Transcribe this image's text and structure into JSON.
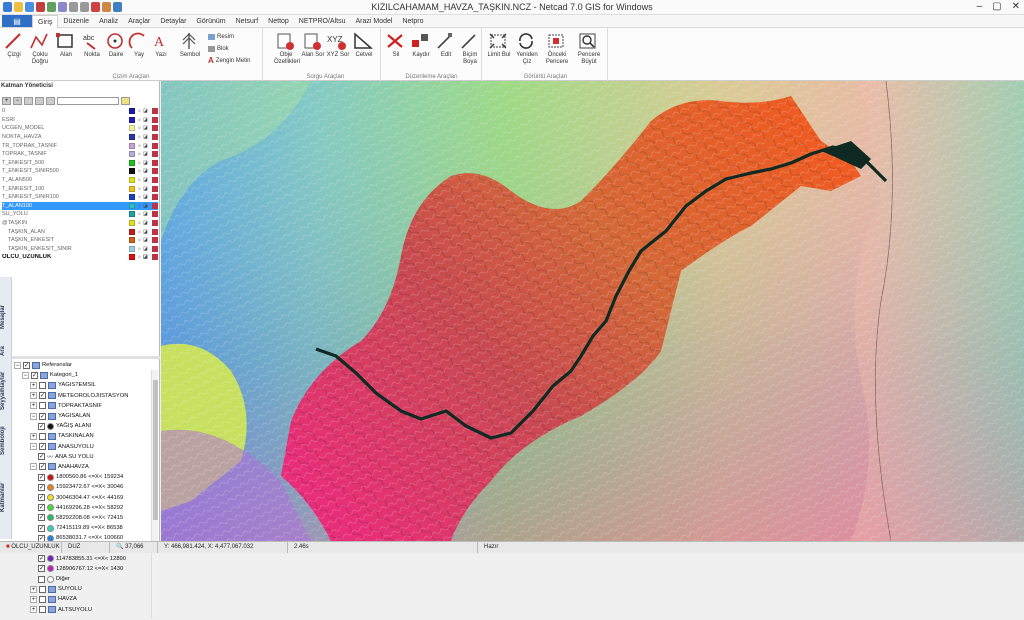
{
  "window": {
    "title": "KIZILCAHAMAM_HAVZA_TAŞKIN.NCZ - Netcad 7.0 GIS for Windows"
  },
  "menu": [
    "Giriş",
    "Düzenle",
    "Analiz",
    "Araçlar",
    "Detaylar",
    "Görünüm",
    "Netsurf",
    "Nettop",
    "NETPRO/Altsu",
    "Arazi Model",
    "Netpro"
  ],
  "ribbon": {
    "draw_tools": [
      "Çizgi",
      "Çoklu Doğru",
      "Alan",
      "Nokta",
      "Daire",
      "Yay",
      "Yazı",
      "Sembol"
    ],
    "draw_small": [
      "Resim",
      "Blok",
      "Zengin Metin"
    ],
    "draw_group": "Çizim Araçları",
    "query_tools": [
      "Obje Özellikleri",
      "Alan Sor",
      "XYZ Sor",
      "Cetvel"
    ],
    "query_group": "Sorgu Araçları",
    "edit_tools": [
      "Sil",
      "Kaydır",
      "Edit",
      "Biçim Boya"
    ],
    "edit_group": "Düzenleme Araçları",
    "view_tools": [
      "Limit Bul",
      "Yeniden Çiz",
      "Önceki Pencere",
      "Pencere Büyüt"
    ],
    "view_group": "Görüntü Araçları"
  },
  "layer_manager": {
    "title": "Katman Yöneticisi",
    "layers": [
      {
        "name": "0",
        "color": "#1a1aa8"
      },
      {
        "name": "ESRI",
        "color": "#2020b0"
      },
      {
        "name": "UCGEN_MODEL",
        "color": "#f0f0a0"
      },
      {
        "name": "NOKTA_HAVZA",
        "color": "#2a3aa8"
      },
      {
        "name": "TR_TOPRAK_TASNIF",
        "color": "#c9a0d8"
      },
      {
        "name": "TOPRAK_TASNIF",
        "color": "#b0b0e0"
      },
      {
        "name": "T_ENKESIT_500",
        "color": "#20c020"
      },
      {
        "name": "T_ENKESIT_SINIR500",
        "color": "#101010"
      },
      {
        "name": "T_ALAN500",
        "color": "#e0e020"
      },
      {
        "name": "T_ENKESIT_100",
        "color": "#f0c020"
      },
      {
        "name": "T_ENKESIT_SINIR100",
        "color": "#2040c0"
      },
      {
        "name": "T_ALAN100",
        "color": "#30c0c0",
        "selected": true
      },
      {
        "name": "SU_YOLU",
        "color": "#20a0a0"
      },
      {
        "name": "@TAŞKIN",
        "color": "#e0e020"
      },
      {
        "name": "TAŞKIN_ALAN",
        "color": "#c02020"
      },
      {
        "name": "TAŞKIN_ENKESIT",
        "color": "#d06020"
      },
      {
        "name": "TAŞKIN_ENKESIT_SINIR",
        "color": "#a0d0e0"
      },
      {
        "name": "OLCU_UZUNLUK",
        "color": "#e01010",
        "bold": true
      }
    ]
  },
  "side_tabs": [
    "Katmanlar",
    "Semboloji",
    "Seyyaihlaylar",
    "Ara",
    "Mesajlar"
  ],
  "tree": {
    "rows": [
      {
        "level": 0,
        "exp": "−",
        "label": "Referanslar",
        "checked": true
      },
      {
        "level": 1,
        "exp": "−",
        "label": "Kategori_1",
        "checked": true
      },
      {
        "level": 2,
        "exp": "+",
        "label": "YAGIS?EMSIL",
        "checked": false
      },
      {
        "level": 2,
        "exp": "+",
        "label": "METEOROLOJIISTASYON",
        "checked": true
      },
      {
        "level": 2,
        "exp": "+",
        "label": "TOPRAKTASNIF",
        "checked": false
      },
      {
        "level": 2,
        "exp": "−",
        "label": "YAGISALAN",
        "checked": true
      },
      {
        "level": 3,
        "label": "YAĞIŞ ALANI",
        "checked": true,
        "dot": "#111"
      },
      {
        "level": 2,
        "exp": "+",
        "label": "TASKINALAN",
        "checked": false
      },
      {
        "level": 2,
        "exp": "−",
        "label": "ANASUYOLU",
        "checked": true
      },
      {
        "level": 3,
        "label": "ANA SU YOLU",
        "checked": true,
        "line": true
      },
      {
        "level": 2,
        "exp": "−",
        "label": "ANAHAVZA",
        "checked": true
      },
      {
        "level": 3,
        "label": "1800560.86 <=X< 159234",
        "checked": true,
        "dot": "#d01010"
      },
      {
        "level": 3,
        "label": "15923472.67 <=X< 30046",
        "checked": true,
        "dot": "#f08020"
      },
      {
        "level": 3,
        "label": "30046304.47 <=X< 44169",
        "checked": true,
        "dot": "#f0e020"
      },
      {
        "level": 3,
        "label": "44169296.28 <=X< 58292",
        "checked": true,
        "dot": "#40e030"
      },
      {
        "level": 3,
        "label": "58292208.08 <=X< 72415",
        "checked": true,
        "dot": "#20c060"
      },
      {
        "level": 3,
        "label": "72415119.89 <=X< 86538",
        "checked": true,
        "dot": "#30d0c0"
      },
      {
        "level": 3,
        "label": "86538031.7 <=X< 100660",
        "checked": true,
        "dot": "#2080e0"
      },
      {
        "level": 3,
        "label": "100660943.5 <=X< 11478",
        "checked": true,
        "dot": "#1020c0"
      },
      {
        "level": 3,
        "label": "114783855.31 <=X< 12890",
        "checked": true,
        "dot": "#7020c0"
      },
      {
        "level": 3,
        "label": "128906767.12 <=X< 1430",
        "checked": true,
        "dot": "#c020c0"
      },
      {
        "level": 3,
        "label": "Diğer",
        "checked": false,
        "dot": "#fff"
      },
      {
        "level": 2,
        "exp": "+",
        "label": "SUYOLU",
        "checked": false
      },
      {
        "level": 2,
        "exp": "+",
        "label": "HAVZA",
        "checked": false
      },
      {
        "level": 2,
        "exp": "+",
        "label": "ALTSUYOLU",
        "checked": false
      }
    ]
  },
  "status": {
    "layer": "OLCU_UZUNLUK",
    "mode": "DUZ",
    "scale": "37,066",
    "coords": "Y: 466,981.424, X: 4,477,067.032",
    "zoom": "2.46s",
    "state": "Hazır"
  },
  "colors": {
    "accent": "#2f6fc6",
    "selection": "#3399ff",
    "basin_high": "#e83070",
    "basin_low": "#f05a20"
  }
}
